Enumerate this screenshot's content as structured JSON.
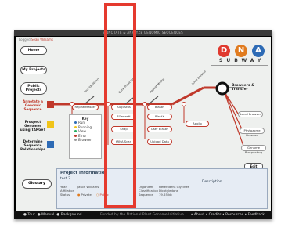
{
  "window": {
    "title": "ANNOTATE & ANALYZE GENOMIC SEQUENCES",
    "user_prefix": "Logged",
    "user_name": "Sean Williams"
  },
  "logo": {
    "letters": [
      "D",
      "N",
      "A"
    ],
    "colors": [
      "#e03a2f",
      "#e07b1f",
      "#2e6bb5"
    ],
    "subway": "SUBWAY"
  },
  "sidebar": {
    "home": "Home",
    "my_projects": "My Projects",
    "public_projects": "Public Projects",
    "lines": [
      {
        "label": "Annotate a Genomic Sequence",
        "color": "#c0392b"
      },
      {
        "label": "Prospect Genomes using TARGeT",
        "color": "#f0c419"
      },
      {
        "label": "Determine Sequence Relationships",
        "color": "#2e6bb5"
      }
    ],
    "glossary": "Glossary"
  },
  "map": {
    "stations": [
      "Four Identifiers",
      "Gene Predictors",
      "Repeat Masker",
      "Local Browser",
      "Browsers & Transfer"
    ],
    "stops_col1": [
      "RepeatMasker",
      "FGenesH"
    ],
    "stops_col2": [
      "Augustus",
      "FGenesH",
      "Snap",
      "tRNA Scan"
    ],
    "stops_col3": [
      "BlastN",
      "BlastX",
      "User BlastN",
      "Upload Data"
    ],
    "stops_col4": [
      "Apollo"
    ],
    "stops_col5": [
      "Local Browser",
      "Phytozome Browser",
      "Genome Prospecting"
    ]
  },
  "legend": {
    "title": "Key",
    "items": [
      {
        "label": "Run",
        "color": "#2e6bb5"
      },
      {
        "label": "Running",
        "color": "#f0c419"
      },
      {
        "label": "View",
        "color": "#27ae60"
      },
      {
        "label": "Error",
        "color": "#c0392b"
      },
      {
        "label": "Browser",
        "color": "#999999"
      }
    ]
  },
  "project": {
    "title": "Project Information",
    "name": "test 2",
    "edit": "Edit",
    "description_label": "Description",
    "fields": [
      {
        "label": "Year",
        "value": "Jason Williams"
      },
      {
        "label": "Affiliation",
        "value": ""
      },
      {
        "label": "Status",
        "value": "Private"
      },
      {
        "label": "Public",
        "value": "Public"
      },
      {
        "label": "Organism",
        "value": "Heterodera Glycines"
      },
      {
        "label": "Classification",
        "value": "Dicotyledons"
      },
      {
        "label": "Sequence",
        "value": "Sequence"
      },
      {
        "label": "Size",
        "value": "79.65 kb"
      }
    ]
  },
  "footer": {
    "tour": "Tour",
    "manual": "Manual",
    "background": "Background",
    "middle": "Funded by the National Plant Genome Initiative",
    "links": [
      "About",
      "Credits",
      "Resources",
      "Feedback"
    ]
  }
}
